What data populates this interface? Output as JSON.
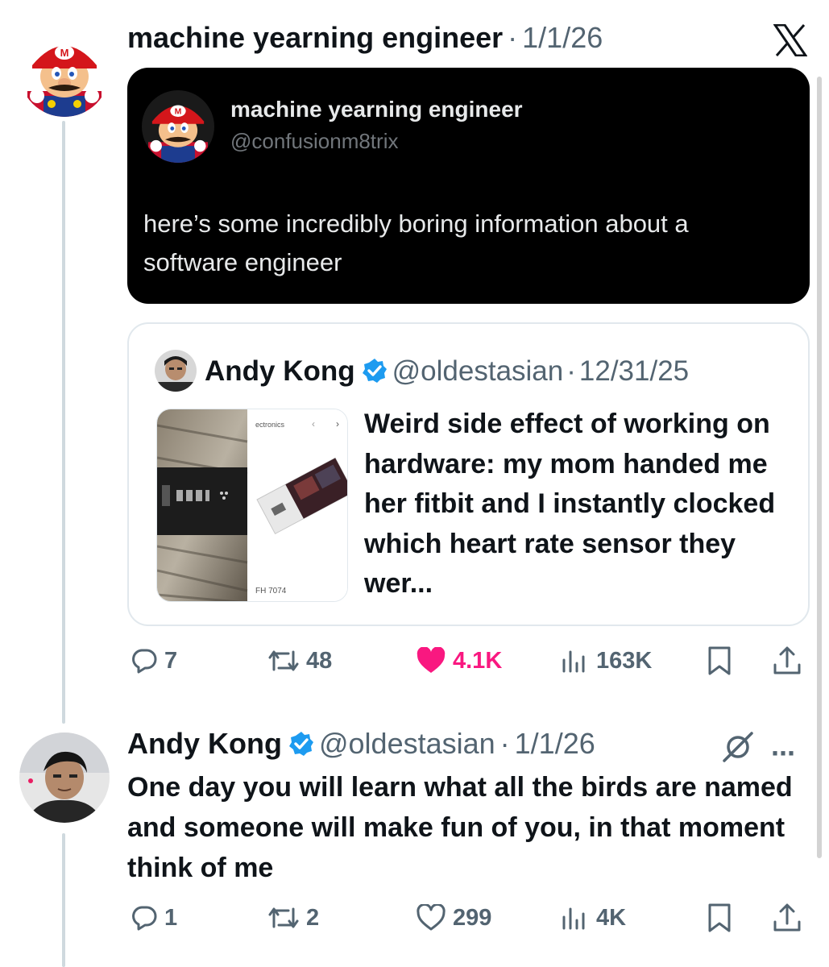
{
  "colors": {
    "text": "#0f1419",
    "secondary": "#536471",
    "like": "#f91880",
    "verified": "#1d9bf0",
    "border": "#e1e8ed",
    "dark_card": "#000000"
  },
  "platform_logo": "x-logo-icon",
  "post": {
    "author_name": "machine yearning engineer",
    "separator": "·",
    "date": "1/1/26",
    "avatar_icon": "mario-avatar",
    "screenshot": {
      "name": "machine yearning engineer",
      "handle": "@confusionm8trix",
      "text": "here’s some incredibly boring information about a software engineer"
    },
    "quote": {
      "name": "Andy Kong",
      "verified_icon": "verified-badge-icon",
      "handle": "@oldestasian",
      "separator": "·",
      "date": "12/31/25",
      "image_labels": {
        "top": "ectronics",
        "bottom": "FH 7074"
      },
      "text": "Weird side effect of working on hardware: my mom handed me her fitbit and I instantly clocked which heart rate sensor they wer..."
    },
    "actions": {
      "replies": "7",
      "reposts": "48",
      "likes": "4.1K",
      "views": "163K",
      "liked": true
    }
  },
  "reply": {
    "author_name": "Andy Kong",
    "verified_icon": "verified-badge-icon",
    "handle": "@oldestasian",
    "separator": "·",
    "date": "1/1/26",
    "more": "···",
    "text": "One day you will learn what all the birds are named and someone will make fun of you, in that moment think of me",
    "actions": {
      "replies": "1",
      "reposts": "2",
      "likes": "299",
      "views": "4K",
      "liked": false
    }
  }
}
